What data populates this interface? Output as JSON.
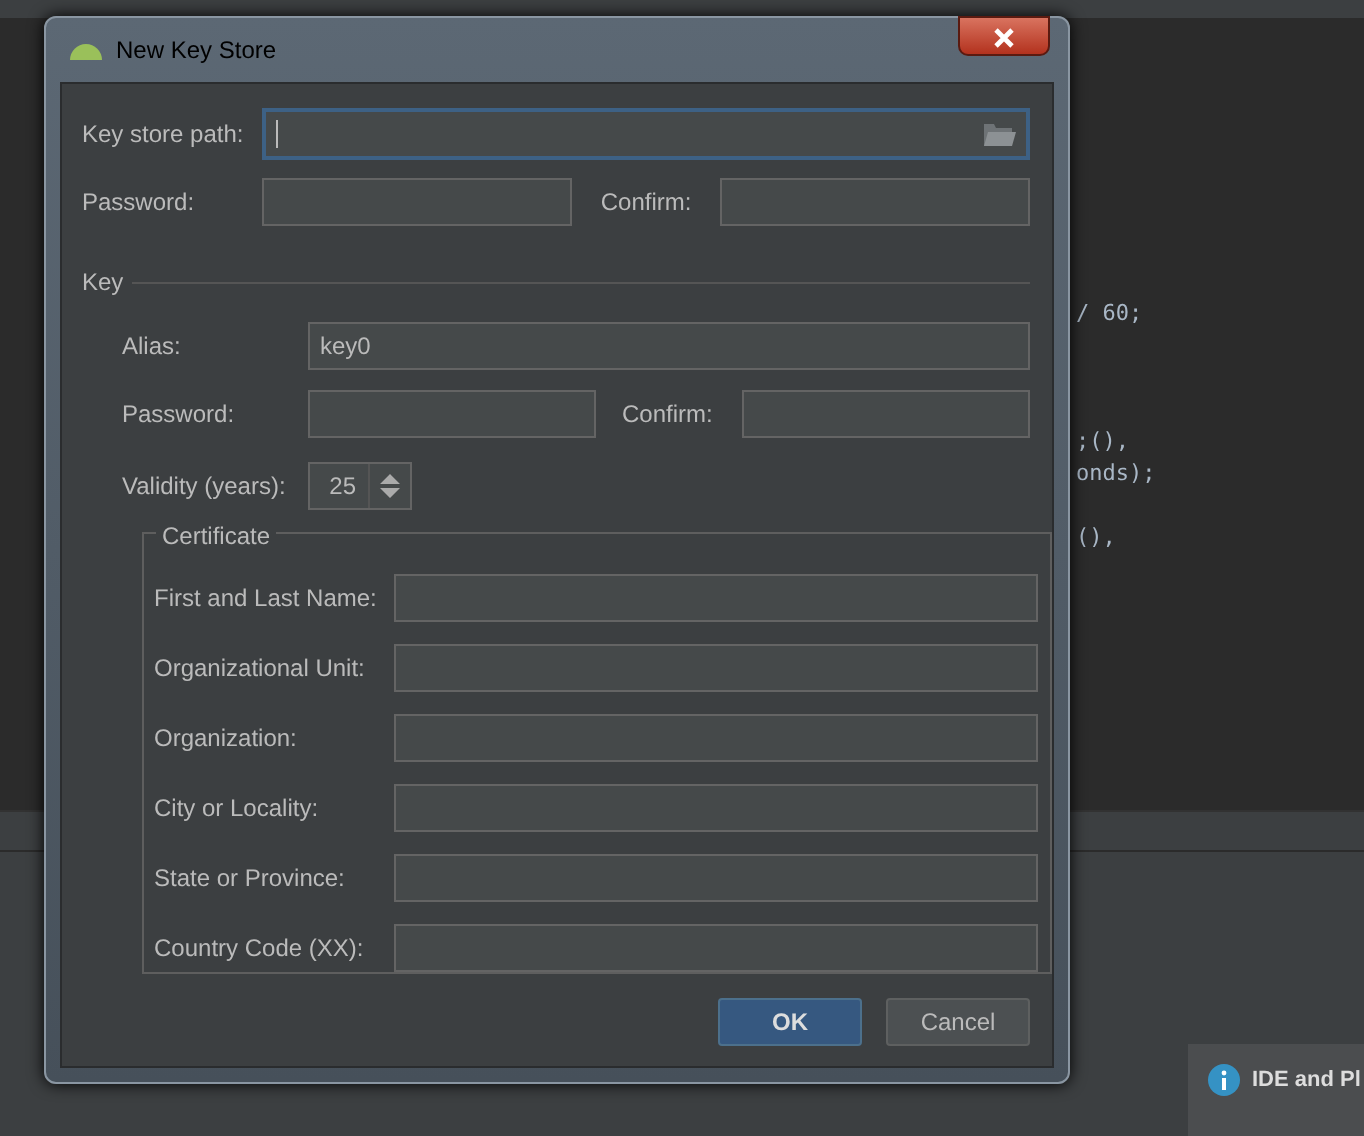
{
  "code_groups": [
    [
      "/ 60;"
    ],
    [
      ";(),",
      "onds);"
    ],
    [
      "(),"
    ]
  ],
  "notification": {
    "title": "IDE and Pl"
  },
  "dialog": {
    "title": "New Key Store",
    "key_store_path": {
      "label": "Key store path:"
    },
    "password": {
      "label": "Password:"
    },
    "confirm": {
      "label": "Confirm:"
    },
    "key_section": {
      "title": "Key",
      "alias": {
        "label": "Alias:",
        "value": "key0"
      },
      "password": {
        "label": "Password:"
      },
      "confirm": {
        "label": "Confirm:"
      },
      "validity": {
        "label": "Validity (years):",
        "value": "25"
      },
      "certificate": {
        "title": "Certificate",
        "fields": [
          {
            "label": "First and Last Name:"
          },
          {
            "label": "Organizational Unit:"
          },
          {
            "label": "Organization:"
          },
          {
            "label": "City or Locality:"
          },
          {
            "label": "State or Province:"
          },
          {
            "label": "Country Code (XX):"
          }
        ]
      }
    },
    "buttons": [
      {
        "label": "OK",
        "default": true
      },
      {
        "label": "Cancel",
        "default": false
      }
    ]
  }
}
